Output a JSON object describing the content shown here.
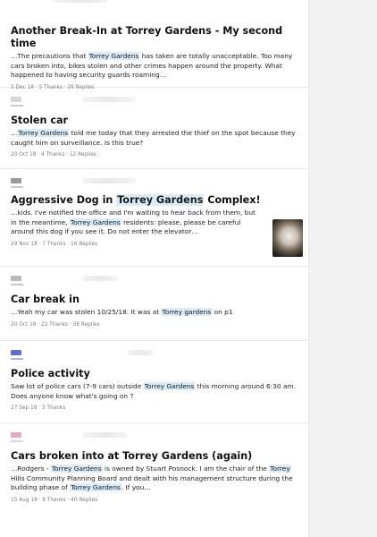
{
  "posts": [
    {
      "title": "Another Break-In at Torrey Gardens - My second time",
      "excerpt_parts": [
        "…The precautions that ",
        "Torrey Gardens",
        " has taken are totally unacceptable. Too many cars broken into, bikes stolen and other crimes happen around the property. What happened to having security guards roaming…"
      ],
      "meta": "5 Dec 18 · 5 Thanks · 29 Replies",
      "avatar_color": "#d8d8d8"
    },
    {
      "title": "Stolen car",
      "excerpt_parts": [
        "…",
        "Torrey Gardens",
        " told me today that they arrested the thief on the spot because they caught him on surveillance. Is this true?"
      ],
      "meta": "20 Oct 18 · 4 Thanks · 12 Replies",
      "avatar_color": "#d6d6d6"
    },
    {
      "title_parts": [
        "Aggressive Dog in ",
        "Torrey Gardens",
        " Complex!"
      ],
      "excerpt_parts": [
        "…kids.  I've notified the office and I'm waiting to hear back from them, but in the meantime, ",
        "Torrey Gardens",
        " residents: please, please be careful around this dog if you see it. Do not enter the elevator…"
      ],
      "meta": "29 Nov 18 · 7 Thanks · 16 Replies",
      "avatar_color": "#9a9a9a"
    },
    {
      "title": "Car break in",
      "excerpt_parts": [
        "…Yeah my car was stolen 10/25/18. It was at ",
        "Torrey gardens",
        " on p1"
      ],
      "meta": "20 Oct 18 · 22 Thanks · 38 Replies",
      "avatar_color": "#b8b8b8"
    },
    {
      "title": "Police activity",
      "excerpt_parts": [
        "Saw lot of police cars (7-9 cars) outside ",
        "Torrey Gardens",
        " this morning around 6:30 am. Does anyone know what's going on ?"
      ],
      "meta": "27 Sep 18 · 3 Thanks",
      "avatar_color": "#5a6fd6"
    },
    {
      "title": "Cars broken into at Torrey Gardens (again)",
      "excerpt_parts": [
        "…Rodgers - ",
        "Torrey Gardens",
        " is owned by Stuart Posnock. I am the chair of the ",
        "Torrey",
        " Hills Community Planning Board and dealt with his management structure during the building phase of ",
        "Torrey Gardens",
        ". If you…"
      ],
      "meta": "15 Aug 18 · 9 Thanks · 40 Replies",
      "avatar_color": "#e7a7c8"
    }
  ]
}
